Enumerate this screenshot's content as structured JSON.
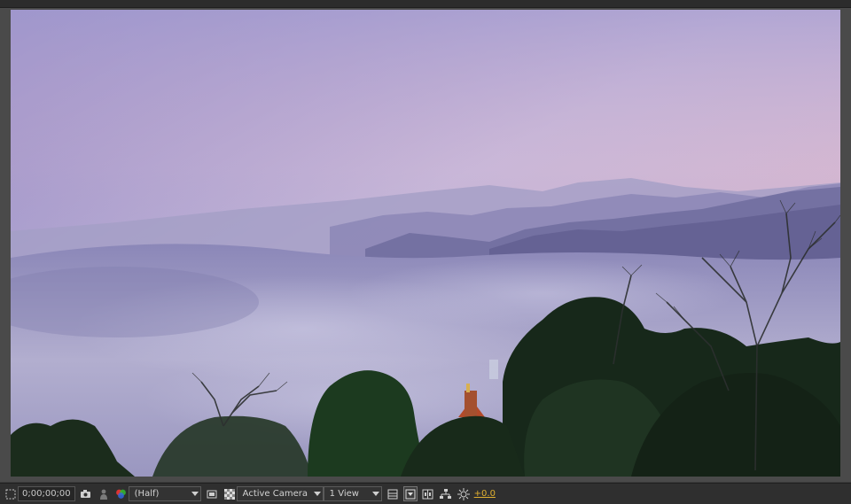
{
  "viewer": {
    "scene": "mountain-sea-of-clouds-at-dusk"
  },
  "footer": {
    "timecode": "0;00;00;00",
    "resolution": "(Half)",
    "camera": "Active Camera",
    "views": "1 View",
    "exposure": "+0.0",
    "icons": [
      "region-of-interest-icon",
      "snapshot-camera-icon",
      "show-snapshot-icon",
      "color-channels-icon",
      "mask-visibility-icon",
      "transparency-grid-icon",
      "3d-renderer-icon",
      "fast-preview-icon",
      "timeline-icon",
      "flowchart-icon",
      "reset-exposure-icon"
    ]
  },
  "colors": {
    "exposure": "#e0b030"
  }
}
